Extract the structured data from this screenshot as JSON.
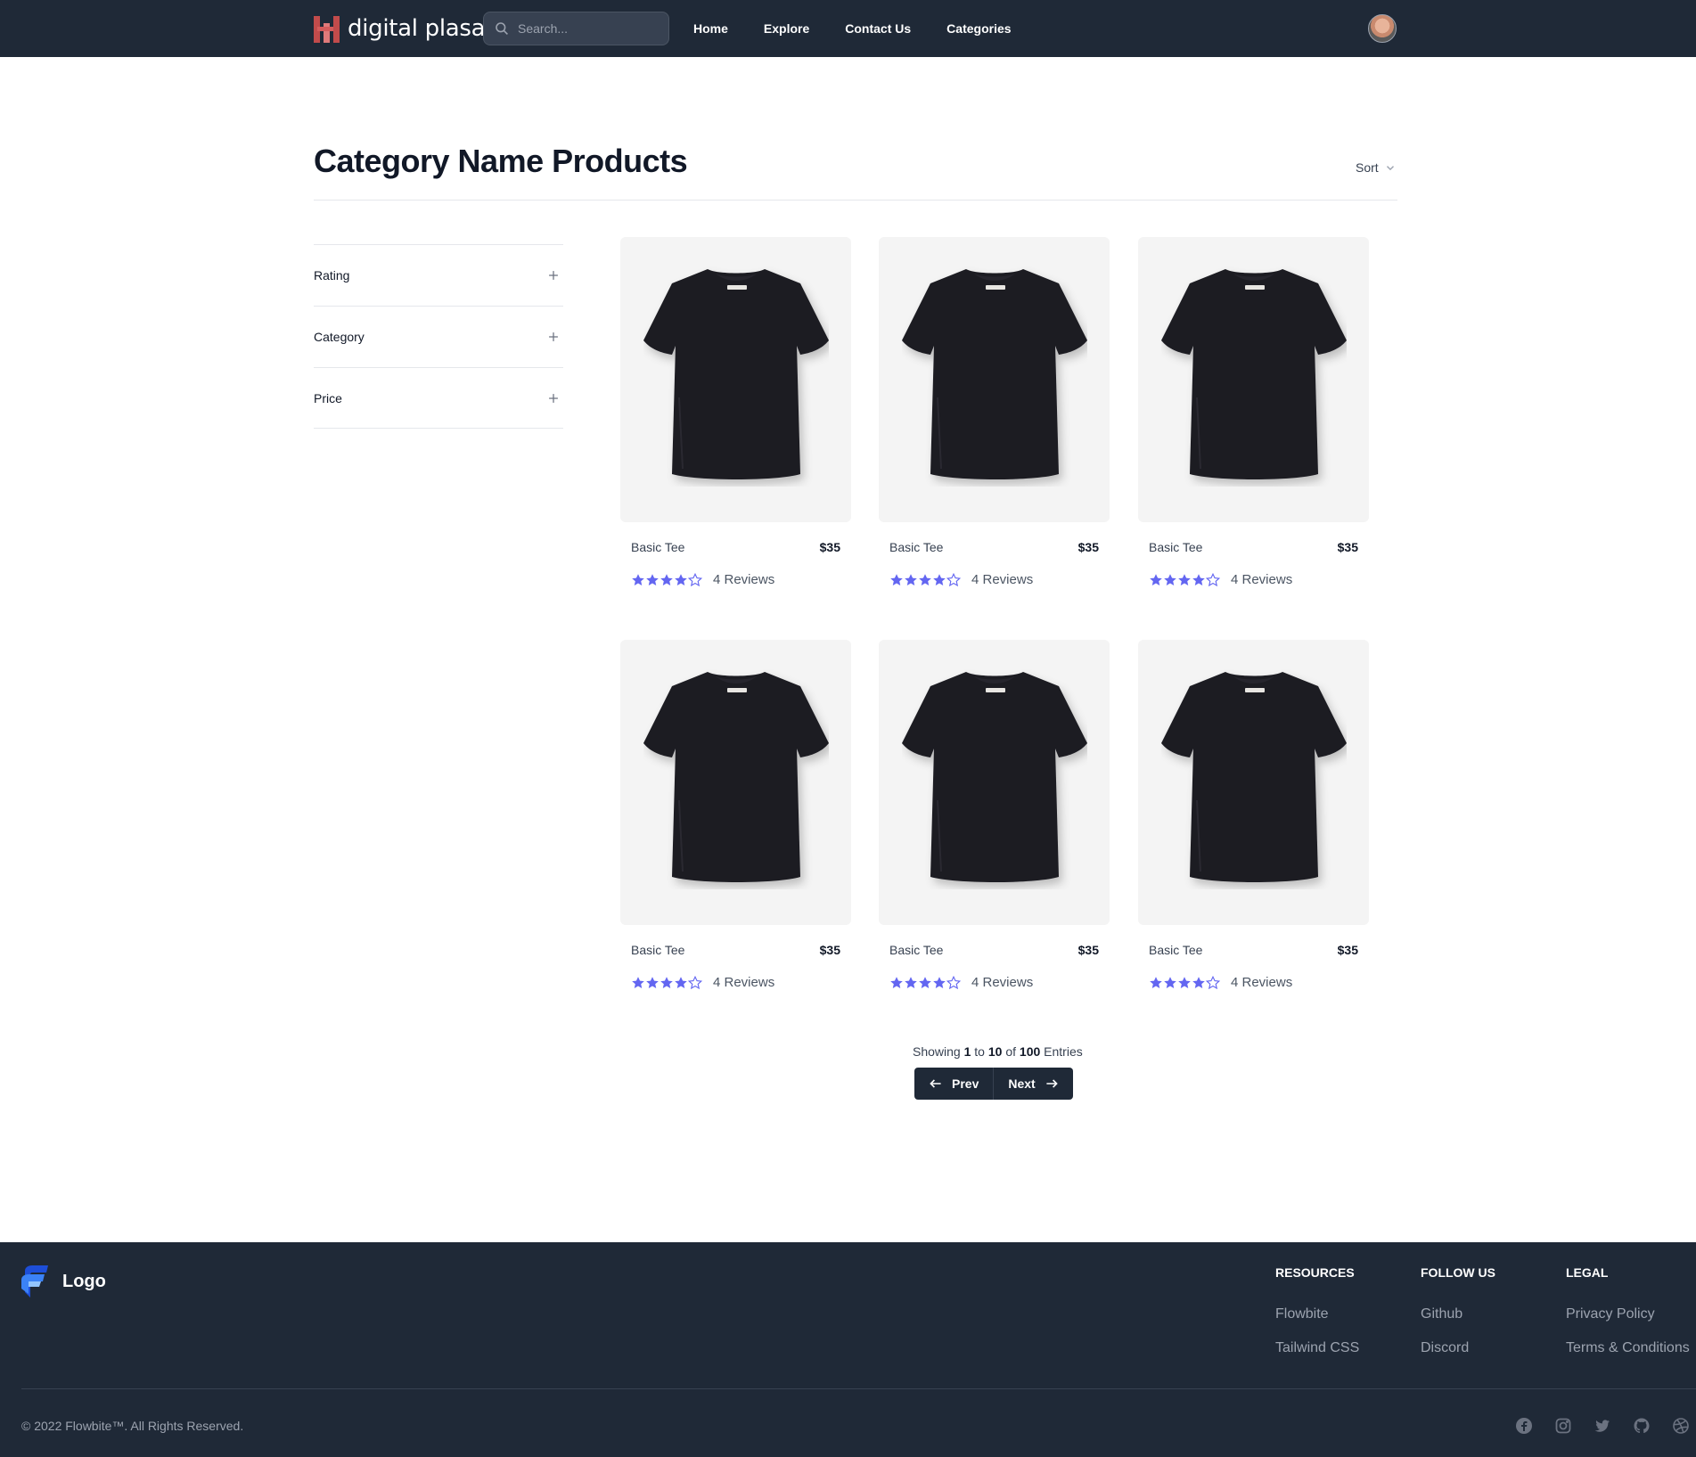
{
  "navbar": {
    "brand_name": "digital plasa",
    "search_placeholder": "Search...",
    "links": [
      "Home",
      "Explore",
      "Contact Us",
      "Categories"
    ]
  },
  "header": {
    "title": "Category Name Products",
    "sort_label": "Sort"
  },
  "filters": [
    "Rating",
    "Category",
    "Price"
  ],
  "products": [
    {
      "name": "Basic Tee",
      "price": "$35",
      "rating": 4,
      "reviews": "4 Reviews"
    },
    {
      "name": "Basic Tee",
      "price": "$35",
      "rating": 4,
      "reviews": "4 Reviews"
    },
    {
      "name": "Basic Tee",
      "price": "$35",
      "rating": 4,
      "reviews": "4 Reviews"
    },
    {
      "name": "Basic Tee",
      "price": "$35",
      "rating": 4,
      "reviews": "4 Reviews"
    },
    {
      "name": "Basic Tee",
      "price": "$35",
      "rating": 4,
      "reviews": "4 Reviews"
    },
    {
      "name": "Basic Tee",
      "price": "$35",
      "rating": 4,
      "reviews": "4 Reviews"
    }
  ],
  "pagination": {
    "showing_prefix": "Showing",
    "from": "1",
    "to_word": "to",
    "to": "10",
    "of_word": "of",
    "total": "100",
    "suffix": "Entries",
    "prev_label": "Prev",
    "next_label": "Next"
  },
  "footer": {
    "logo_text": "Logo",
    "columns": [
      {
        "title": "Resources",
        "links": [
          "Flowbite",
          "Tailwind CSS"
        ]
      },
      {
        "title": "Follow us",
        "links": [
          "Github",
          "Discord"
        ]
      },
      {
        "title": "Legal",
        "links": [
          "Privacy Policy",
          "Terms & Conditions"
        ]
      }
    ],
    "copyright": "© 2022 Flowbite™. All Rights Reserved.",
    "social_icons": [
      "facebook-icon",
      "instagram-icon",
      "twitter-icon",
      "github-icon",
      "dribbble-icon"
    ]
  },
  "colors": {
    "navbar_bg": "#1f2937",
    "star_filled": "#6366f1",
    "brand_red": "#c24b4b",
    "brand_pink": "#e07a7a"
  }
}
